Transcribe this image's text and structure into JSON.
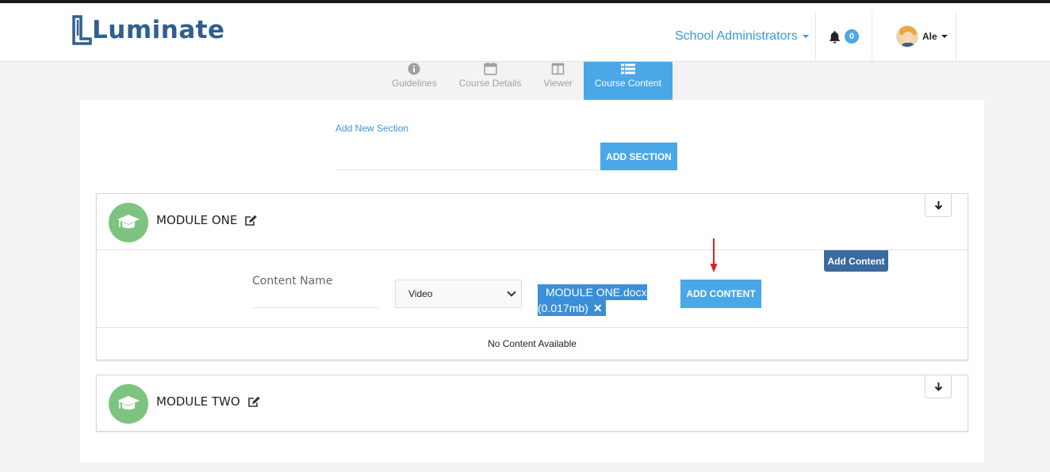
{
  "header": {
    "logo_text": "Luminate",
    "role_label": "School Administrators",
    "notification_count": "0",
    "user_name": "Ale"
  },
  "tabs": [
    {
      "label": "Guidelines",
      "icon": "info-circle-icon"
    },
    {
      "label": "Course Details",
      "icon": "calendar-icon"
    },
    {
      "label": "Viewer",
      "icon": "columns-icon"
    },
    {
      "label": "Course Content",
      "icon": "list-icon",
      "active": true
    }
  ],
  "add_section": {
    "label": "Add New Section",
    "button": "ADD SECTION"
  },
  "modules": [
    {
      "title": "MODULE ONE",
      "add_content_tag": "Add Content",
      "content_name_placeholder": "Content Name",
      "content_type": "Video",
      "file_name": "MODULE ONE.docx",
      "file_size": "(0.017mb)",
      "add_button": "ADD CONTENT",
      "empty_text": "No Content Available"
    },
    {
      "title": "MODULE TWO"
    }
  ],
  "colors": {
    "accent": "#4aa7e8",
    "module_icon": "#7cc47f",
    "add_tag": "#3a6a9e",
    "arrow": "#e02020"
  }
}
